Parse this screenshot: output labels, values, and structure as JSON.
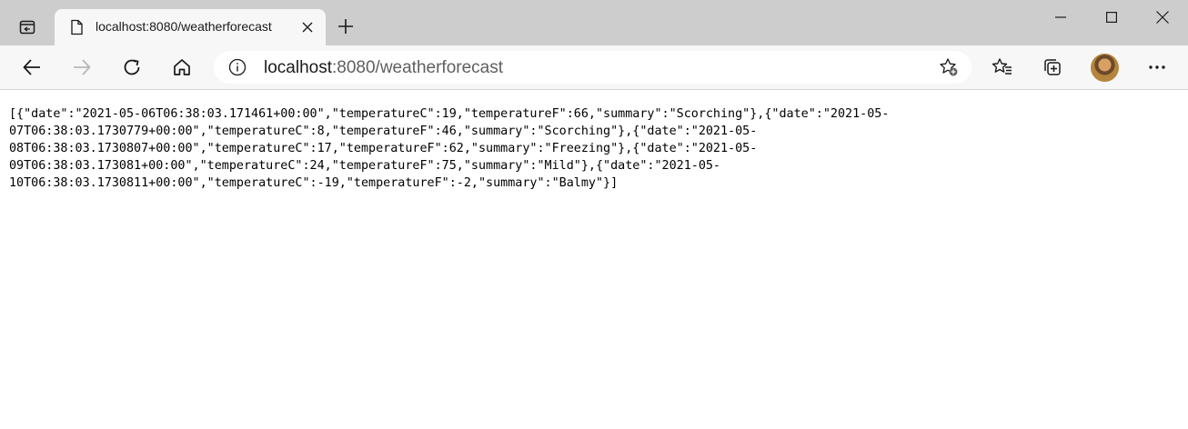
{
  "browser": {
    "tab": {
      "title": "localhost:8080/weatherforecast"
    },
    "address": {
      "host": "localhost",
      "path": ":8080/weatherforecast"
    },
    "icons": {
      "tab_actions": "tab-actions-icon",
      "favicon": "page-icon",
      "tab_close": "close-icon",
      "new_tab": "plus-icon",
      "minimize": "minimize-icon",
      "maximize": "maximize-icon",
      "window_close": "close-icon",
      "back": "arrow-left-icon",
      "forward": "arrow-right-icon",
      "reload": "refresh-icon",
      "home": "home-icon",
      "site_info": "info-icon",
      "add_favorite": "star-plus-icon",
      "favorites": "favorites-icon",
      "collections": "collections-icon",
      "more": "ellipsis-icon"
    }
  },
  "page": {
    "lines": [
      "[{\"date\":\"2021-05-06T06:38:03.171461+00:00\",\"temperatureC\":19,\"temperatureF\":66,\"summary\":\"Scorching\"},{\"date\":\"2021-05-",
      "07T06:38:03.1730779+00:00\",\"temperatureC\":8,\"temperatureF\":46,\"summary\":\"Scorching\"},{\"date\":\"2021-05-",
      "08T06:38:03.1730807+00:00\",\"temperatureC\":17,\"temperatureF\":62,\"summary\":\"Freezing\"},{\"date\":\"2021-05-",
      "09T06:38:03.173081+00:00\",\"temperatureC\":24,\"temperatureF\":75,\"summary\":\"Mild\"},{\"date\":\"2021-05-",
      "10T06:38:03.1730811+00:00\",\"temperatureC\":-19,\"temperatureF\":-2,\"summary\":\"Balmy\"}]"
    ]
  }
}
